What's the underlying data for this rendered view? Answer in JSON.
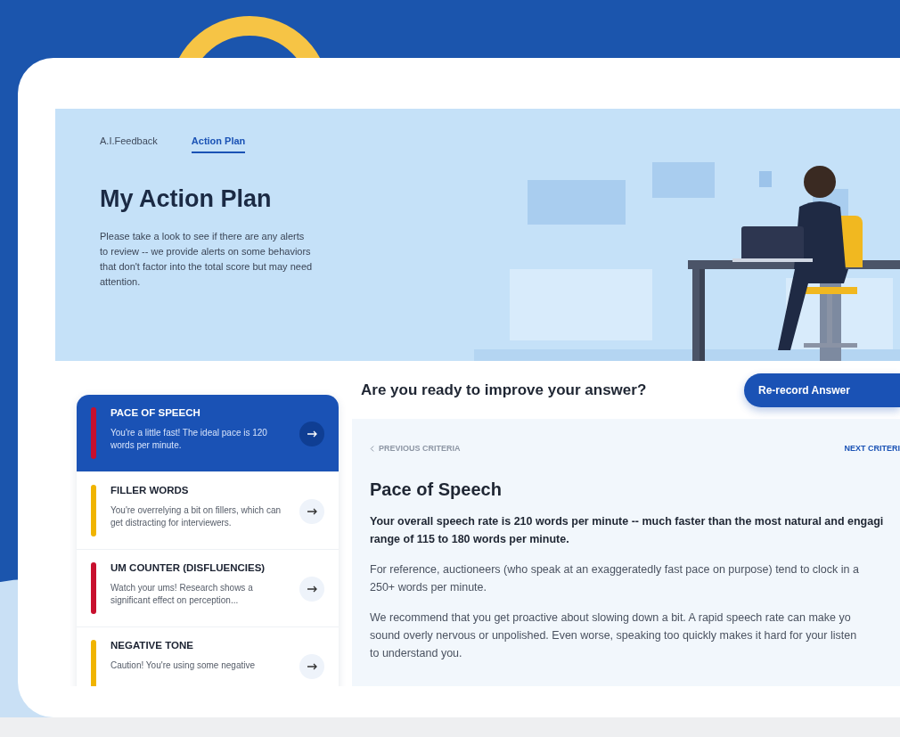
{
  "tabs": [
    {
      "label": "A.I.Feedback",
      "selected": false
    },
    {
      "label": "Action Plan",
      "selected": true
    }
  ],
  "hero": {
    "title": "My Action Plan",
    "description": "Please take a look to see if there are any alerts to review -- we provide alerts on some behaviors that don't factor into the total score but may need attention."
  },
  "prompt": {
    "question": "Are you ready to improve your answer?",
    "button": "Re-record Answer"
  },
  "criteria": [
    {
      "title": "PACE OF SPEECH",
      "description": "You're a little fast! The ideal pace is 120 words per minute.",
      "color": "#c8102e",
      "selected": true
    },
    {
      "title": "FILLER WORDS",
      "description": "You're overrelying a bit on fillers, which can get distracting for interviewers.",
      "color": "#f0b400",
      "selected": false
    },
    {
      "title": "UM COUNTER (DISFLUENCIES)",
      "description": "Watch your ums! Research shows a significant effect on perception...",
      "color": "#c8102e",
      "selected": false
    },
    {
      "title": "NEGATIVE TONE",
      "description": "Caution! You're using some negative",
      "color": "#f0b400",
      "selected": false
    }
  ],
  "detail": {
    "previous": "PREVIOUS CRITERIA",
    "previous_disabled": true,
    "next": "NEXT CRITERI",
    "title": "Pace of Speech",
    "paragraphs": [
      {
        "emphasis": true,
        "lines": [
          "Your overall speech rate is 210 words per minute -- much faster than the most natural and engagi",
          "range of 115 to 180 words per minute."
        ]
      },
      {
        "emphasis": false,
        "lines": [
          "For reference, auctioneers (who speak at an exaggeratedly fast pace on purpose) tend to clock in a",
          "250+ words per minute."
        ]
      },
      {
        "emphasis": false,
        "lines": [
          "We recommend that you get proactive about slowing down a bit. A rapid speech rate can make yo",
          "sound overly nervous or unpolished. Even worse, speaking too quickly makes it hard for your listen",
          "to understand you."
        ]
      }
    ]
  }
}
